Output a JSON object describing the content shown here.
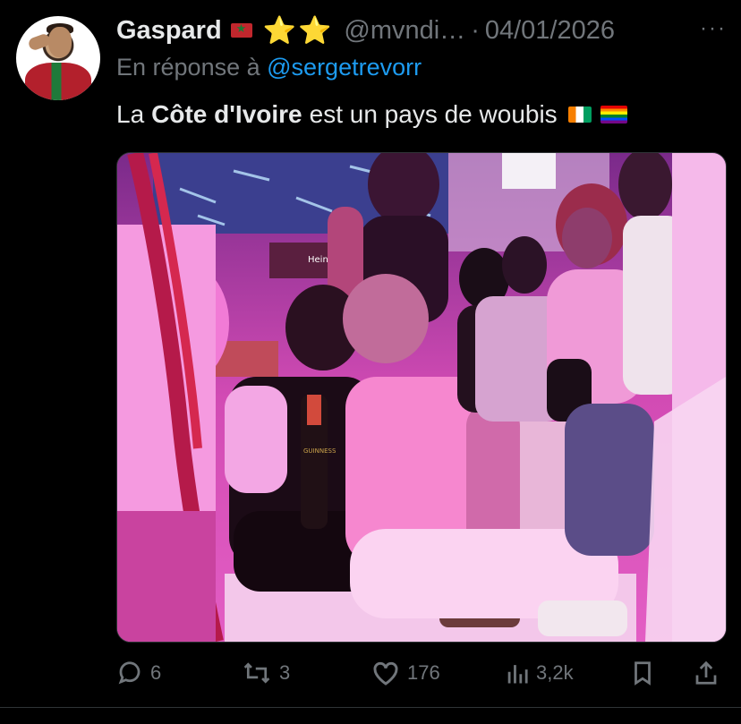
{
  "tweet": {
    "author_name": "Gaspard",
    "badges": "⭐⭐",
    "handle": "@mvndi…",
    "separator": "·",
    "date": "04/01/2026",
    "more": "···",
    "reply_prefix": "En réponse à",
    "reply_mention": "@sergetrevorr",
    "text_before": "La",
    "text_bold": "Côte d'Ivoire",
    "text_after": "est un pays de woubis",
    "image_bottle_label": "GUINNESS",
    "image_sign_label": "Heine"
  },
  "actions": {
    "replies": "6",
    "reposts": "3",
    "likes": "176",
    "views": "3,2k"
  },
  "colors": {
    "background": "#000000",
    "text": "#e7e9ea",
    "muted": "#71767b",
    "link": "#1d9bf0",
    "photo_tint": "#c03ca3"
  }
}
